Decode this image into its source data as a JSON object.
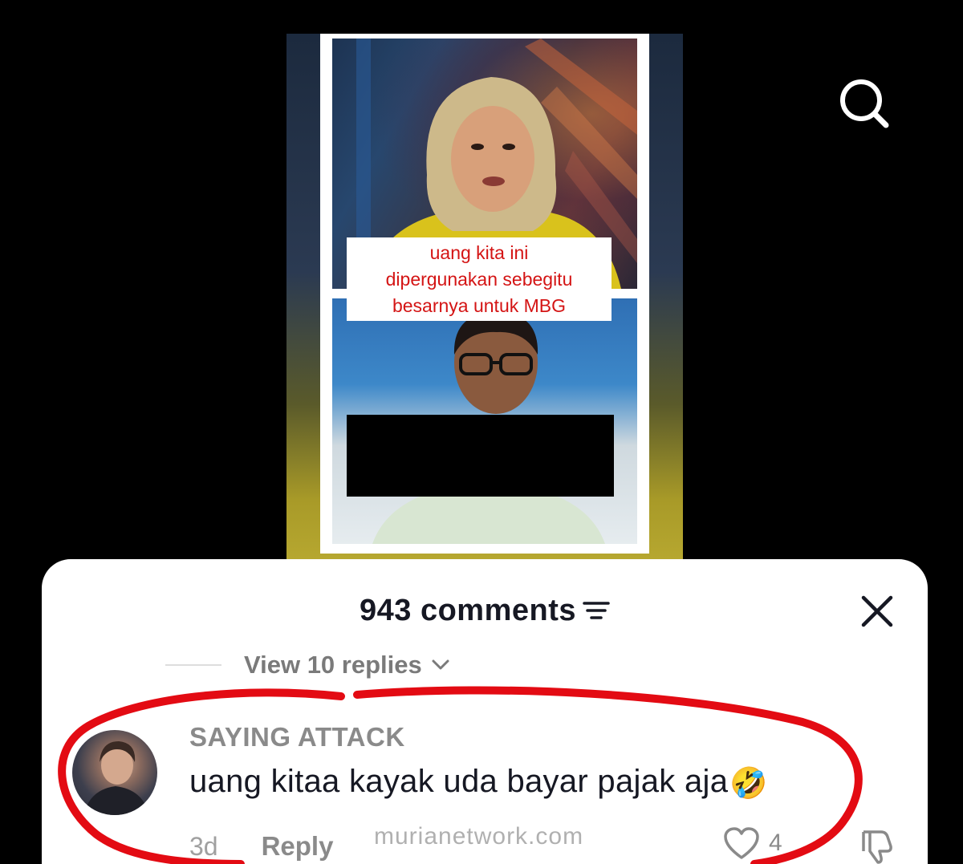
{
  "video": {
    "caption": "uang kita ini\ndipergunakan sebegitu\nbesarnya untuk MBG",
    "caption_color": "#d41414"
  },
  "top_bar": {
    "search_icon": "search-icon"
  },
  "comments_sheet": {
    "title": "943 comments",
    "filter_icon": "filter-icon",
    "close_icon": "close-icon",
    "view_replies": "View 10 replies",
    "comment": {
      "username": "SAYING ATTACK",
      "text": "uang kitaa kayak uda bayar pajak aja",
      "emoji": "🤣",
      "timestamp": "3d",
      "reply_label": "Reply",
      "like_count": "4"
    }
  },
  "annotation": {
    "highlight_color": "#e30b13"
  },
  "watermark": "murianetwork.com"
}
